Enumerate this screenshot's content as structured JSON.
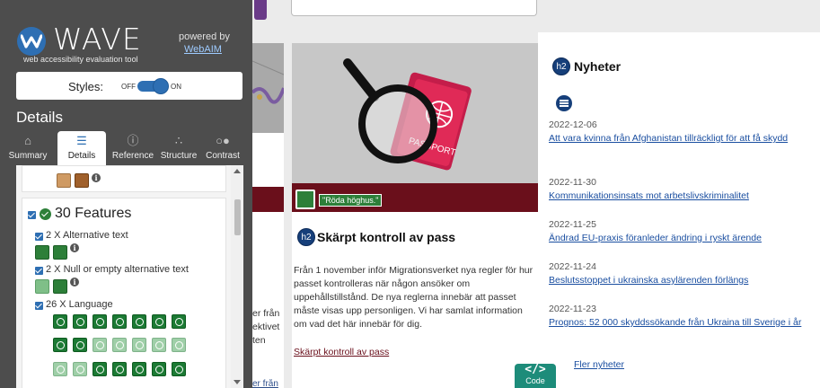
{
  "wave": {
    "brand": "WAVE",
    "tagline": "web accessibility evaluation tool",
    "powered_by": "powered by",
    "webaim": "WebAIM",
    "styles_label": "Styles:",
    "styles_off": "OFF",
    "styles_on": "ON",
    "details_title": "Details",
    "tabs": [
      "Summary",
      "Details",
      "Reference",
      "Structure",
      "Contrast"
    ],
    "features_heading": "30 Features",
    "feature_groups": [
      {
        "label": "2 X Alternative text"
      },
      {
        "label": "2 X Null or empty alternative text"
      },
      {
        "label": "26 X Language"
      }
    ],
    "colors": {
      "panel_bg": "#4d4d4d",
      "accent": "#2e6fb3",
      "feature_green": "#2d7f39"
    }
  },
  "page": {
    "alt_badge_text": "\"Röda höghus.\"",
    "h2_badge": "h2",
    "card_title": "Skärpt kontroll av pass",
    "card_body": "Från 1 november inför Migrationsverket nya regler för hur passet kontrolleras när någon ansöker om uppehållstillstånd. De nya reglerna innebär att passet måste visas upp personligen. Vi har samlat information om vad det här innebär för dig.",
    "card_link": "Skärpt kontroll av pass",
    "cut_left_lines": [
      "er från",
      "ektivet",
      "ten"
    ],
    "cut_left_link": "er från",
    "news_title": "Nyheter",
    "news": [
      {
        "date": "2022-12-06",
        "title": "Att vara kvinna från Afghanistan tillräckligt för att få skydd"
      },
      {
        "date": "2022-11-30",
        "title": "Kommunikationsinsats mot arbetslivskriminalitet"
      },
      {
        "date": "2022-11-25",
        "title": "Ändrad EU-praxis föranleder ändring i ryskt ärende"
      },
      {
        "date": "2022-11-24",
        "title": "Beslutsstoppet i ukrainska asylärenden förlängs"
      },
      {
        "date": "2022-11-23",
        "title": "Prognos: 52 000 skyddssökande från Ukraina till Sverige i år"
      }
    ],
    "news_more": "Fler nyheter",
    "code_label": "Code",
    "code_icon": "</>"
  }
}
